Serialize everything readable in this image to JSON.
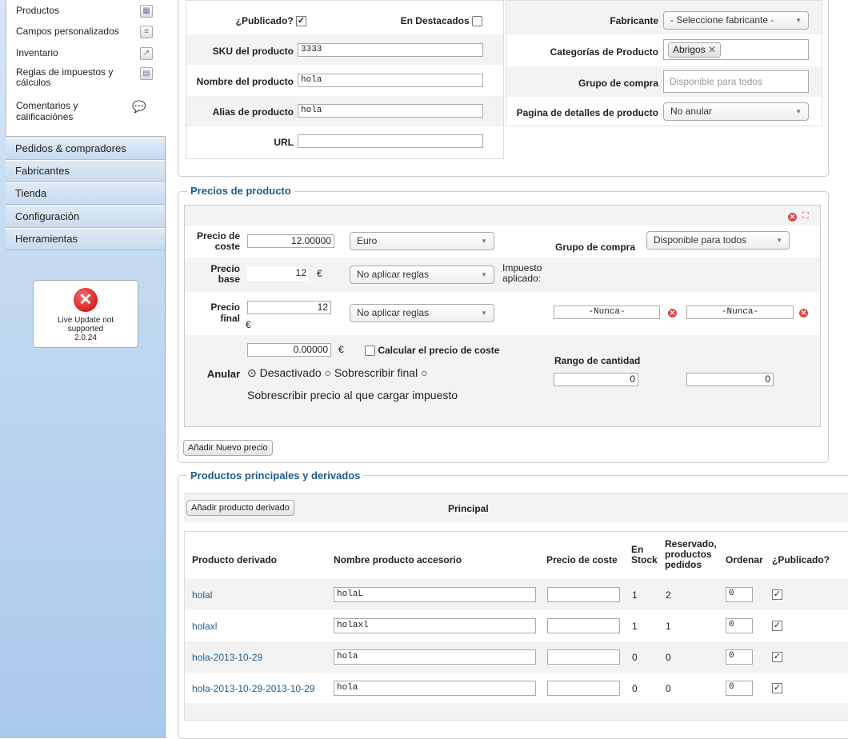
{
  "sidebar": {
    "submenu": [
      {
        "label": "Productos",
        "icon": "products-icon"
      },
      {
        "label": "Campos personalizados",
        "icon": "custom-fields-icon"
      },
      {
        "label": "Inventario",
        "icon": "inventory-icon"
      },
      {
        "label": "Reglas de impuestos y cálculos",
        "icon": "tax-rules-icon"
      },
      {
        "label": "Comentarios y calificaciónes",
        "icon": "comments-icon"
      }
    ],
    "nav": [
      "Pedidos & compradores",
      "Fabricantes",
      "Tienda",
      "Configuración",
      "Herramientas"
    ],
    "live_update": {
      "line1": "Live Update not",
      "line2": "supported",
      "version": "2.0.24"
    }
  },
  "product": {
    "published_label": "¿Publicado?",
    "featured_label": "En Destacados",
    "sku_label": "SKU del producto",
    "sku": "3333",
    "name_label": "Nombre del producto",
    "name": "hola",
    "alias_label": "Alias de producto",
    "alias": "hola",
    "url_label": "URL",
    "url": "",
    "manufacturer_label": "Fabricante",
    "manufacturer": "- Seleccione fabricante -",
    "categories_label": "Categorías de Producto",
    "category_tag": "Abrigos",
    "shopper_group_label": "Grupo de compra",
    "shopper_group_placeholder": "Disponible para todos",
    "details_page_label": "Pagina de detalles de producto",
    "details_page": "No anular"
  },
  "prices": {
    "legend": "Precios de producto",
    "cost_label_1": "Precio de",
    "cost_label_2": "coste",
    "cost_value": "12.00000",
    "currency": "Euro",
    "group_label": "Grupo de compra",
    "group_value": "Disponible para todos",
    "base_label_1": "Precio",
    "base_label_2": "base",
    "base_value": "12",
    "euro": "€",
    "base_rule": "No aplicar reglas",
    "tax_label_1": "Impuesto",
    "tax_label_2": "aplicado:",
    "final_label_1": "Precio",
    "final_label_2": "final",
    "final_value": "12",
    "final_rule": "No aplicar reglas",
    "date_start": "-Nunca-",
    "date_end": "-Nunca-",
    "override_value": "0.00000",
    "calc_cost_label": "Calcular el precio de coste",
    "override_label": "Anular",
    "opt_disabled": "Desactivado",
    "opt_override_final": "Sobrescribir final",
    "opt_override_tax": "Sobrescribir precio al que cargar impuesto",
    "qty_range_label": "Rango de cantidad",
    "qty_from": "0",
    "qty_to": "0",
    "add_price_button": "Añadir Nuevo precio"
  },
  "variants": {
    "legend": "Productos principales y derivados",
    "add_child_button": "Añadir producto derivado",
    "principal_label": "Principal",
    "headers": {
      "child": "Producto derivado",
      "accessory_name": "Nombre producto accesorio",
      "cost": "Precio de coste",
      "in_stock_1": "En",
      "in_stock_2": "Stock",
      "reserved_1": "Reservado,",
      "reserved_2": "productos",
      "reserved_3": "pedidos",
      "order": "Ordenar",
      "published": "¿Publicado?"
    },
    "rows": [
      {
        "child": "holal",
        "name": "holaL",
        "cost": "",
        "stock": "1",
        "reserved": "2",
        "order": "0"
      },
      {
        "child": "holaxl",
        "name": "holaxl",
        "cost": "",
        "stock": "1",
        "reserved": "1",
        "order": "0"
      },
      {
        "child": "hola-2013-10-29",
        "name": "hola",
        "cost": "",
        "stock": "0",
        "reserved": "0",
        "order": "0"
      },
      {
        "child": "hola-2013-10-29-2013-10-29",
        "name": "hola",
        "cost": "",
        "stock": "0",
        "reserved": "0",
        "order": "0"
      }
    ]
  }
}
